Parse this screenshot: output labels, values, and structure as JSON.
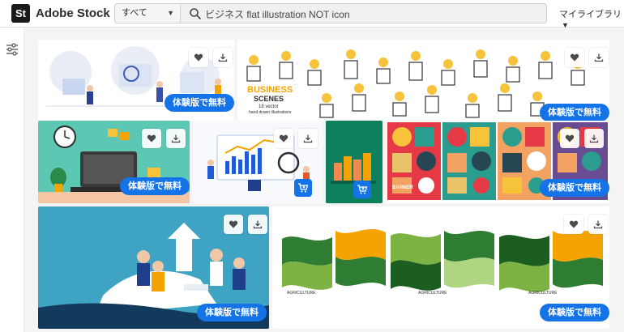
{
  "header": {
    "logo_badge": "St",
    "logo_text": "Adobe Stock",
    "category_value": "すべて",
    "search_value": "ビジネス flat illustration NOT icon",
    "library_label": "マイライブラリ"
  },
  "icons": {
    "search": "search-icon",
    "filter": "filter-icon",
    "heart": "heart-icon",
    "download": "download-icon",
    "cart": "cart-icon",
    "chevron": "chevron-down-icon"
  },
  "tiles": {
    "t1": {
      "trial_label": "体験版で無料"
    },
    "t2": {
      "trial_label": "体験版で無料",
      "title": "BUSINESS",
      "subtitle": "SCENES",
      "caption1": "18 vector",
      "caption2": "hand drawn illustrations"
    },
    "t3": {
      "trial_label": "体験版で無料"
    },
    "t6": {
      "trial_label": "体験版で無料",
      "poster_label": "BANNER"
    },
    "t7": {
      "trial_label": "体験版で無料"
    },
    "t8": {
      "trial_label": "体験版で無料",
      "poster_label1": "AGRICULTURE",
      "poster_label2": "AGRICULTURE",
      "poster_label3": "AGRICULTURE"
    }
  },
  "colors": {
    "accent": "#1473e6",
    "grid_bg": "#f4f4f4",
    "teal": "#5cc8b4",
    "sky": "#3fa3c4",
    "green": "#0e7f5f",
    "orange": "#f5a300"
  }
}
